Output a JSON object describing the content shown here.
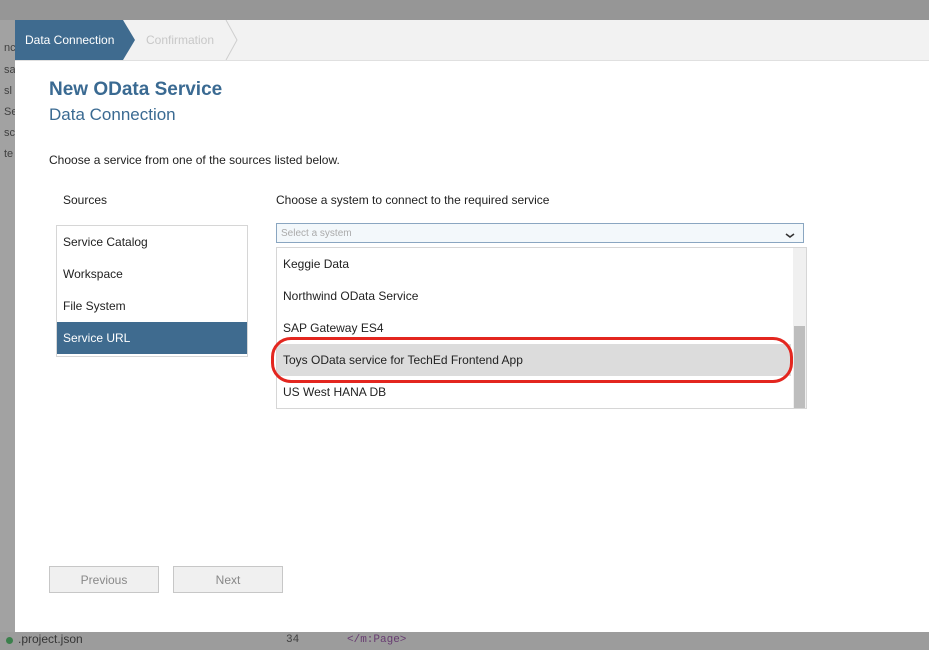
{
  "background": {
    "left_fragments": [
      "nc",
      "sa",
      "sl",
      "Se",
      "sc",
      "te"
    ],
    "project_file": ".project.json",
    "line_number": "34",
    "code_text": "</m:Page>"
  },
  "roadmap": {
    "steps": [
      {
        "label": "Data Connection",
        "active": true
      },
      {
        "label": "Confirmation",
        "active": false
      }
    ]
  },
  "dialog": {
    "title": "New OData Service",
    "subtitle": "Data Connection",
    "instruction": "Choose a service from one of the sources listed below."
  },
  "sources": {
    "label": "Sources",
    "items": [
      {
        "label": "Service Catalog",
        "selected": false
      },
      {
        "label": "Workspace",
        "selected": false
      },
      {
        "label": "File System",
        "selected": false
      },
      {
        "label": "Service URL",
        "selected": true
      }
    ]
  },
  "system": {
    "label": "Choose a system to connect to the required service",
    "placeholder": "Select a system",
    "options": [
      "Keggie Data",
      "Northwind OData Service",
      "SAP Gateway ES4",
      "Toys OData service for TechEd Frontend App",
      "US West HANA DB"
    ],
    "highlighted_index": 3
  },
  "buttons": {
    "previous": "Previous",
    "next": "Next"
  },
  "colors": {
    "accent": "#3f6b8f",
    "title": "#3a6a92",
    "highlight_ring": "#e3261f"
  }
}
